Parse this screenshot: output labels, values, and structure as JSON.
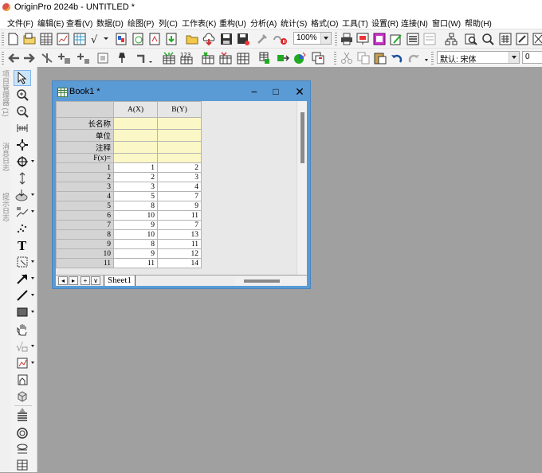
{
  "app": {
    "title": "OriginPro 2024b - UNTITLED *"
  },
  "menu": [
    "文件(F)",
    "编辑(E)",
    "查看(V)",
    "数据(D)",
    "绘图(P)",
    "列(C)",
    "工作表(K)",
    "重构(U)",
    "分析(A)",
    "统计(S)",
    "格式(O)",
    "工具(T)",
    "设置(R)",
    "连接(N)",
    "窗口(W)",
    "帮助(H)"
  ],
  "toolbar": {
    "zoom_value": "100%",
    "font_value": "默认: 宋体",
    "font_size_value": "0"
  },
  "side_panels": [
    "项目管理器 (1)",
    "消息日志",
    "提示日志"
  ],
  "workbook": {
    "title": "Book1 *",
    "minimize": "−",
    "maximize": "□",
    "close": "✕",
    "columns": [
      "A(X)",
      "B(Y)"
    ],
    "meta_rows": [
      "长名称",
      "单位",
      "注释",
      "F(x)="
    ],
    "rows": [
      {
        "n": "1",
        "a": "1",
        "b": "2"
      },
      {
        "n": "2",
        "a": "2",
        "b": "3"
      },
      {
        "n": "3",
        "a": "3",
        "b": "4"
      },
      {
        "n": "4",
        "a": "5",
        "b": "7"
      },
      {
        "n": "5",
        "a": "8",
        "b": "9"
      },
      {
        "n": "6",
        "a": "10",
        "b": "11"
      },
      {
        "n": "7",
        "a": "9",
        "b": "7"
      },
      {
        "n": "8",
        "a": "10",
        "b": "13"
      },
      {
        "n": "9",
        "a": "8",
        "b": "11"
      },
      {
        "n": "10",
        "a": "9",
        "b": "12"
      },
      {
        "n": "11",
        "a": "11",
        "b": "14"
      }
    ],
    "sheet_tab": "Sheet1",
    "nav": [
      "◂",
      "▸",
      "+",
      "∨"
    ]
  },
  "icons": [
    "new-project",
    "new-folder",
    "new-workbook",
    "new-graph",
    "new-matrix",
    "function-plot",
    "new-layout",
    "new-notes",
    "import-wizard",
    "open",
    "save-project",
    "save-template",
    "recalculate",
    "zoom",
    "print",
    "duplicate",
    "code-builder",
    "results-log",
    "command-window",
    "pointer",
    "zoom-in",
    "zoom-out",
    "screen-reader",
    "data-reader",
    "data-selector",
    "annotation",
    "text-tool",
    "region",
    "arrow",
    "line",
    "rectangle",
    "pan",
    "formula",
    "insert-graph",
    "3d-rotate"
  ]
}
